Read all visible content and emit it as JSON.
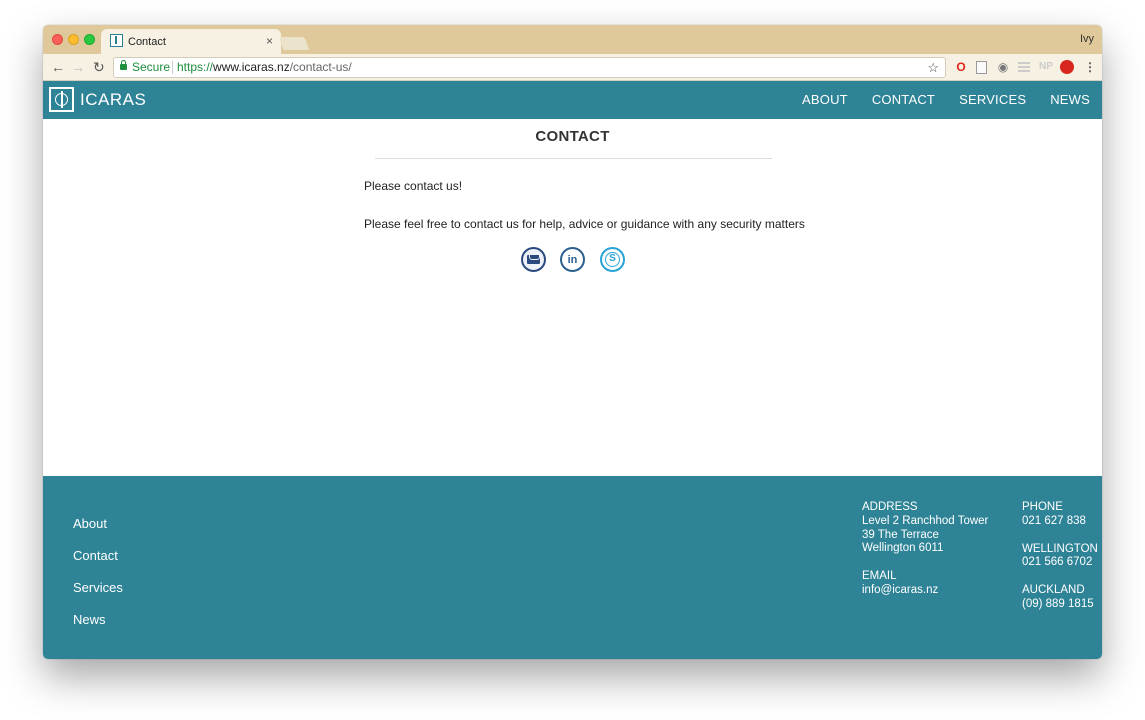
{
  "browser": {
    "tab_title": "Contact",
    "tab_close": "×",
    "profile_name": "Ivy",
    "secure_label": "Secure",
    "url_scheme": "https://",
    "url_host": "www.icaras.nz",
    "url_path": "/contact-us/",
    "icons": {
      "back": "←",
      "forward": "→",
      "reload": "↻",
      "star": "☆",
      "opera": "O",
      "eye": "◉",
      "np": "NP",
      "menu": "⋮"
    }
  },
  "site": {
    "logo_text": "ICARAS",
    "nav": [
      "ABOUT",
      "CONTACT",
      "SERVICES",
      "NEWS"
    ],
    "accent_color": "#2e8396"
  },
  "content": {
    "title": "CONTACT",
    "intro": "Please contact us!",
    "body": "Please feel free to contact us for help, advice or guidance with any security matters",
    "social": {
      "linkedin_glyph": "in",
      "skype_glyph": "S"
    }
  },
  "footer": {
    "links": [
      "About",
      "Contact",
      "Services",
      "News"
    ],
    "address_heading": "ADDRESS",
    "address_lines": [
      "Level 2 Ranchhod Tower",
      "39 The Terrace",
      "Wellington 6011"
    ],
    "email_heading": "EMAIL",
    "email": "info@icaras.nz",
    "phone_heading": "PHONE",
    "phone": "021 627 838",
    "wellington_heading": "WELLINGTON",
    "wellington_phone": "021 566 6702",
    "auckland_heading": "AUCKLAND",
    "auckland_phone": "(09) 889 1815"
  }
}
